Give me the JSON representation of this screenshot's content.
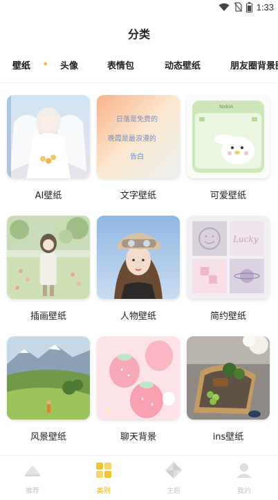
{
  "status_bar": {
    "time": "1:33",
    "icons": [
      "wifi-icon",
      "no-sim-icon",
      "battery-icon"
    ]
  },
  "page": {
    "title": "分类"
  },
  "tabs": [
    {
      "label": "壁纸",
      "active": true
    },
    {
      "label": "头像",
      "active": false
    },
    {
      "label": "表情包",
      "active": false
    },
    {
      "label": "动态壁纸",
      "active": false
    },
    {
      "label": "朋友圈背景图",
      "active": false
    }
  ],
  "categories": [
    {
      "label": "AI壁纸",
      "icon": "ai-wallpaper-thumbnail"
    },
    {
      "label": "文字壁纸",
      "icon": "text-wallpaper-thumbnail",
      "thumb_text": [
        "日落是免费的",
        "晚霞是最浪漫的",
        "告白"
      ]
    },
    {
      "label": "可爱壁纸",
      "icon": "cute-wallpaper-thumbnail",
      "thumb_text": [
        "NokiA"
      ]
    },
    {
      "label": "插画壁纸",
      "icon": "illustration-wallpaper-thumbnail"
    },
    {
      "label": "人物壁纸",
      "icon": "portrait-wallpaper-thumbnail"
    },
    {
      "label": "简约壁纸",
      "icon": "minimal-wallpaper-thumbnail",
      "thumb_text": [
        "Lucky"
      ]
    },
    {
      "label": "风景壁纸",
      "icon": "landscape-wallpaper-thumbnail"
    },
    {
      "label": "聊天背景",
      "icon": "chat-background-thumbnail"
    },
    {
      "label": "ins壁纸",
      "icon": "ins-wallpaper-thumbnail"
    }
  ],
  "bottom_nav": [
    {
      "label": "推荐",
      "icon": "recommend-icon",
      "active": false
    },
    {
      "label": "类别",
      "icon": "category-icon",
      "active": true
    },
    {
      "label": "主题",
      "icon": "theme-icon",
      "active": false
    },
    {
      "label": "我的",
      "icon": "profile-icon",
      "active": false
    }
  ],
  "colors": {
    "accent": "#f2b51d",
    "tab_underline": "#f7c948",
    "nav_inactive": "#c8c8c8",
    "text": "#222222"
  }
}
